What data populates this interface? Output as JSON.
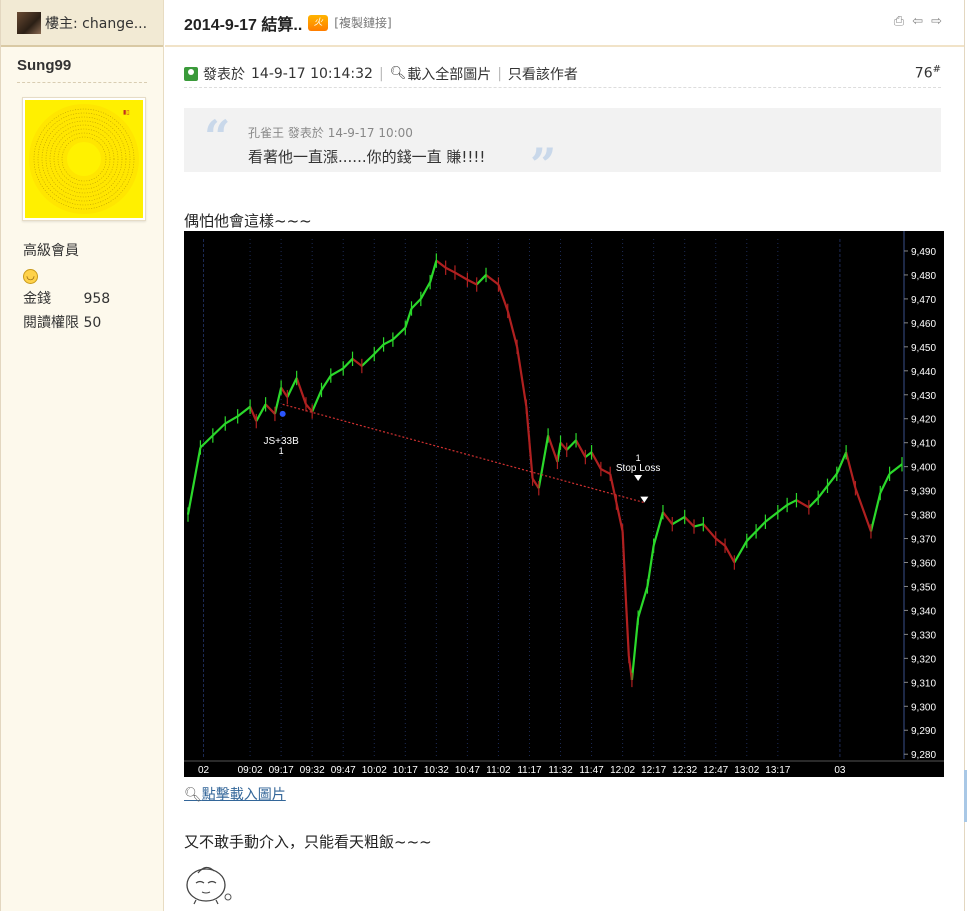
{
  "sidebar": {
    "header_title": "樓主: change...",
    "username": "Sung99",
    "rank": "高級會員",
    "money_label": "金錢",
    "money_value": "958",
    "read_perm_label": "閱讀權限",
    "read_perm_value": "50"
  },
  "thread": {
    "title": "2014-9-17 結算..",
    "hot_badge": "火",
    "copy_link": "[複製鏈接]"
  },
  "post": {
    "posted_prefix": "發表於",
    "posted_at": "14-9-17 10:14:32",
    "load_all_images": "載入全部圖片",
    "author_only": "只看該作者",
    "floor": "76",
    "floor_sup": "#",
    "quote": {
      "author": "孔雀王",
      "posted_prefix": "發表於",
      "posted_at": "14-9-17 10:00",
      "text": "看著他一直漲......你的錢一直 賺!!!!"
    },
    "lead_text": "偶怕他會這樣~~~",
    "load_image_link": "點擊載入圖片",
    "tail_text": "又不敢手動介入，只能看天粗飯~~~"
  },
  "chart_data": {
    "type": "line",
    "title": "",
    "xlabel": "",
    "ylabel": "",
    "ylim": [
      9278,
      9495
    ],
    "y_ticks": [
      "9,280",
      "9,290",
      "9,300",
      "9,310",
      "9,320",
      "9,330",
      "9,340",
      "9,350",
      "9,360",
      "9,370",
      "9,380",
      "9,390",
      "9,400",
      "9,410",
      "9,420",
      "9,430",
      "9,440",
      "9,450",
      "9,460",
      "9,470",
      "9,480",
      "9,490"
    ],
    "x_ticks": [
      "02",
      "09:02",
      "09:17",
      "09:32",
      "09:47",
      "10:02",
      "10:17",
      "10:32",
      "10:47",
      "11:02",
      "11:17",
      "11:32",
      "11:47",
      "12:02",
      "12:17",
      "12:32",
      "12:47",
      "13:02",
      "13:17",
      "03"
    ],
    "x_tick_pos": [
      0.5,
      2,
      3,
      4,
      5,
      6,
      7,
      8,
      9,
      10,
      11,
      12,
      13,
      14,
      15,
      16,
      17,
      18,
      19,
      21
    ],
    "price_x": [
      0,
      0.4,
      0.8,
      1.2,
      1.6,
      2,
      2.2,
      2.5,
      2.8,
      3,
      3.2,
      3.5,
      3.8,
      4,
      4.3,
      4.6,
      5,
      5.3,
      5.6,
      6,
      6.3,
      6.6,
      7,
      7.2,
      7.5,
      7.8,
      8,
      8.3,
      8.6,
      9,
      9.3,
      9.6,
      10,
      10.3,
      10.6,
      10.9,
      11,
      11.1,
      11.3,
      11.6,
      11.9,
      12,
      12.2,
      12.5,
      12.8,
      13,
      13.3,
      13.6,
      13.8,
      14,
      14.1,
      14.2,
      14.3,
      14.5,
      14.8,
      15,
      15.3,
      15.6,
      16,
      16.3,
      16.6,
      17,
      17.3,
      17.6,
      18,
      18.3,
      18.6,
      19,
      19.3,
      19.6,
      20,
      20.3,
      20.6,
      20.9,
      21.2,
      21.5,
      22,
      22.3,
      22.6,
      23
    ],
    "price_y": [
      9380,
      9408,
      9413,
      9418,
      9421,
      9425,
      9419,
      9426,
      9422,
      9433,
      9429,
      9437,
      9426,
      9423,
      9432,
      9438,
      9441,
      9445,
      9442,
      9447,
      9451,
      9453,
      9458,
      9466,
      9470,
      9477,
      9486,
      9483,
      9481,
      9478,
      9476,
      9480,
      9476,
      9465,
      9450,
      9425,
      9410,
      9395,
      9391,
      9413,
      9402,
      9410,
      9407,
      9411,
      9404,
      9406,
      9399,
      9397,
      9385,
      9373,
      9346,
      9321,
      9311,
      9337,
      9350,
      9367,
      9381,
      9376,
      9379,
      9375,
      9376,
      9370,
      9367,
      9360,
      9369,
      9373,
      9377,
      9381,
      9384,
      9386,
      9383,
      9387,
      9392,
      9397,
      9406,
      9391,
      9373,
      9389,
      9397,
      9401,
      9404
    ],
    "trade_line": [
      [
        3.05,
        9426
      ],
      [
        14.7,
        9385
      ]
    ],
    "annotations": [
      {
        "label": "JS+33B",
        "sub": "1",
        "x": 3.0,
        "y": 9412
      },
      {
        "label": "Stop Loss",
        "top": "1",
        "x": 14.5,
        "y": 9399
      }
    ],
    "colors": {
      "up": "#2bd92b",
      "down": "#b02020",
      "grid": "#1c2a55",
      "trade": "#d03030",
      "text": "#ffffff",
      "bg": "#000000"
    }
  },
  "colors": {
    "sidebar_bg": "#fdf9ec",
    "accent": "#336699"
  }
}
